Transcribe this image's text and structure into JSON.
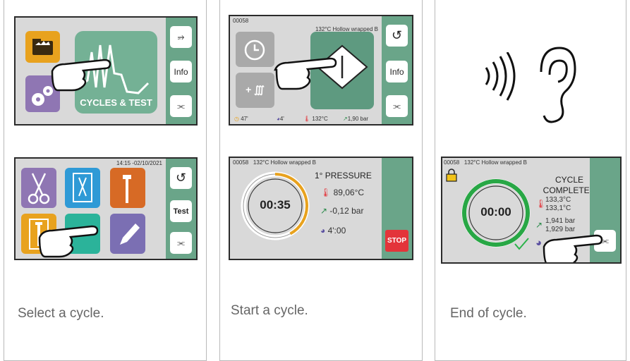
{
  "captions": [
    "Select a cycle.",
    "Start a cycle.",
    "End of cycle."
  ],
  "screen1": {
    "main_tile_label": "CYCLES & TEST",
    "info_label": "Info"
  },
  "screen2": {
    "datetime": "14:15 -02/10/2021",
    "test_label": "Test"
  },
  "screen3": {
    "cycle_number": "00058",
    "program": "132°C Hollow wrapped B",
    "info_label": "Info",
    "heating_symbol": "+ ∭",
    "status": {
      "time": "47'",
      "drying": "4'",
      "temperature": "132°C",
      "pressure": "1,90 bar"
    }
  },
  "screen4": {
    "cycle_number": "00058",
    "program": "132°C Hollow wrapped B",
    "phase": "1° PRESSURE",
    "timer": "00:35",
    "temperature": "89,06°C",
    "pressure": "-0,12 bar",
    "remaining": "4':00",
    "stop_label": "STOP",
    "progress_fraction": 0.42
  },
  "screen5": {
    "cycle_number": "00058",
    "program": "132°C Hollow wrapped B",
    "status_line1": "CYCLE",
    "status_line2": "COMPLETED",
    "timer": "00:00",
    "temp1": "133,3°C",
    "temp2": "133,1°C",
    "pres1": "1,941 bar",
    "pres2": "1,929 bar",
    "progress_fraction": 1.0
  },
  "colors": {
    "panel_green": "#6aa589",
    "tile_green": "#74b195",
    "stop_red": "#e3343a",
    "orange": "#e8a21e",
    "purple": "#8f76b3",
    "blue": "#2f9ad6",
    "burnt_orange": "#d76a25",
    "ring_green": "#28a745"
  }
}
